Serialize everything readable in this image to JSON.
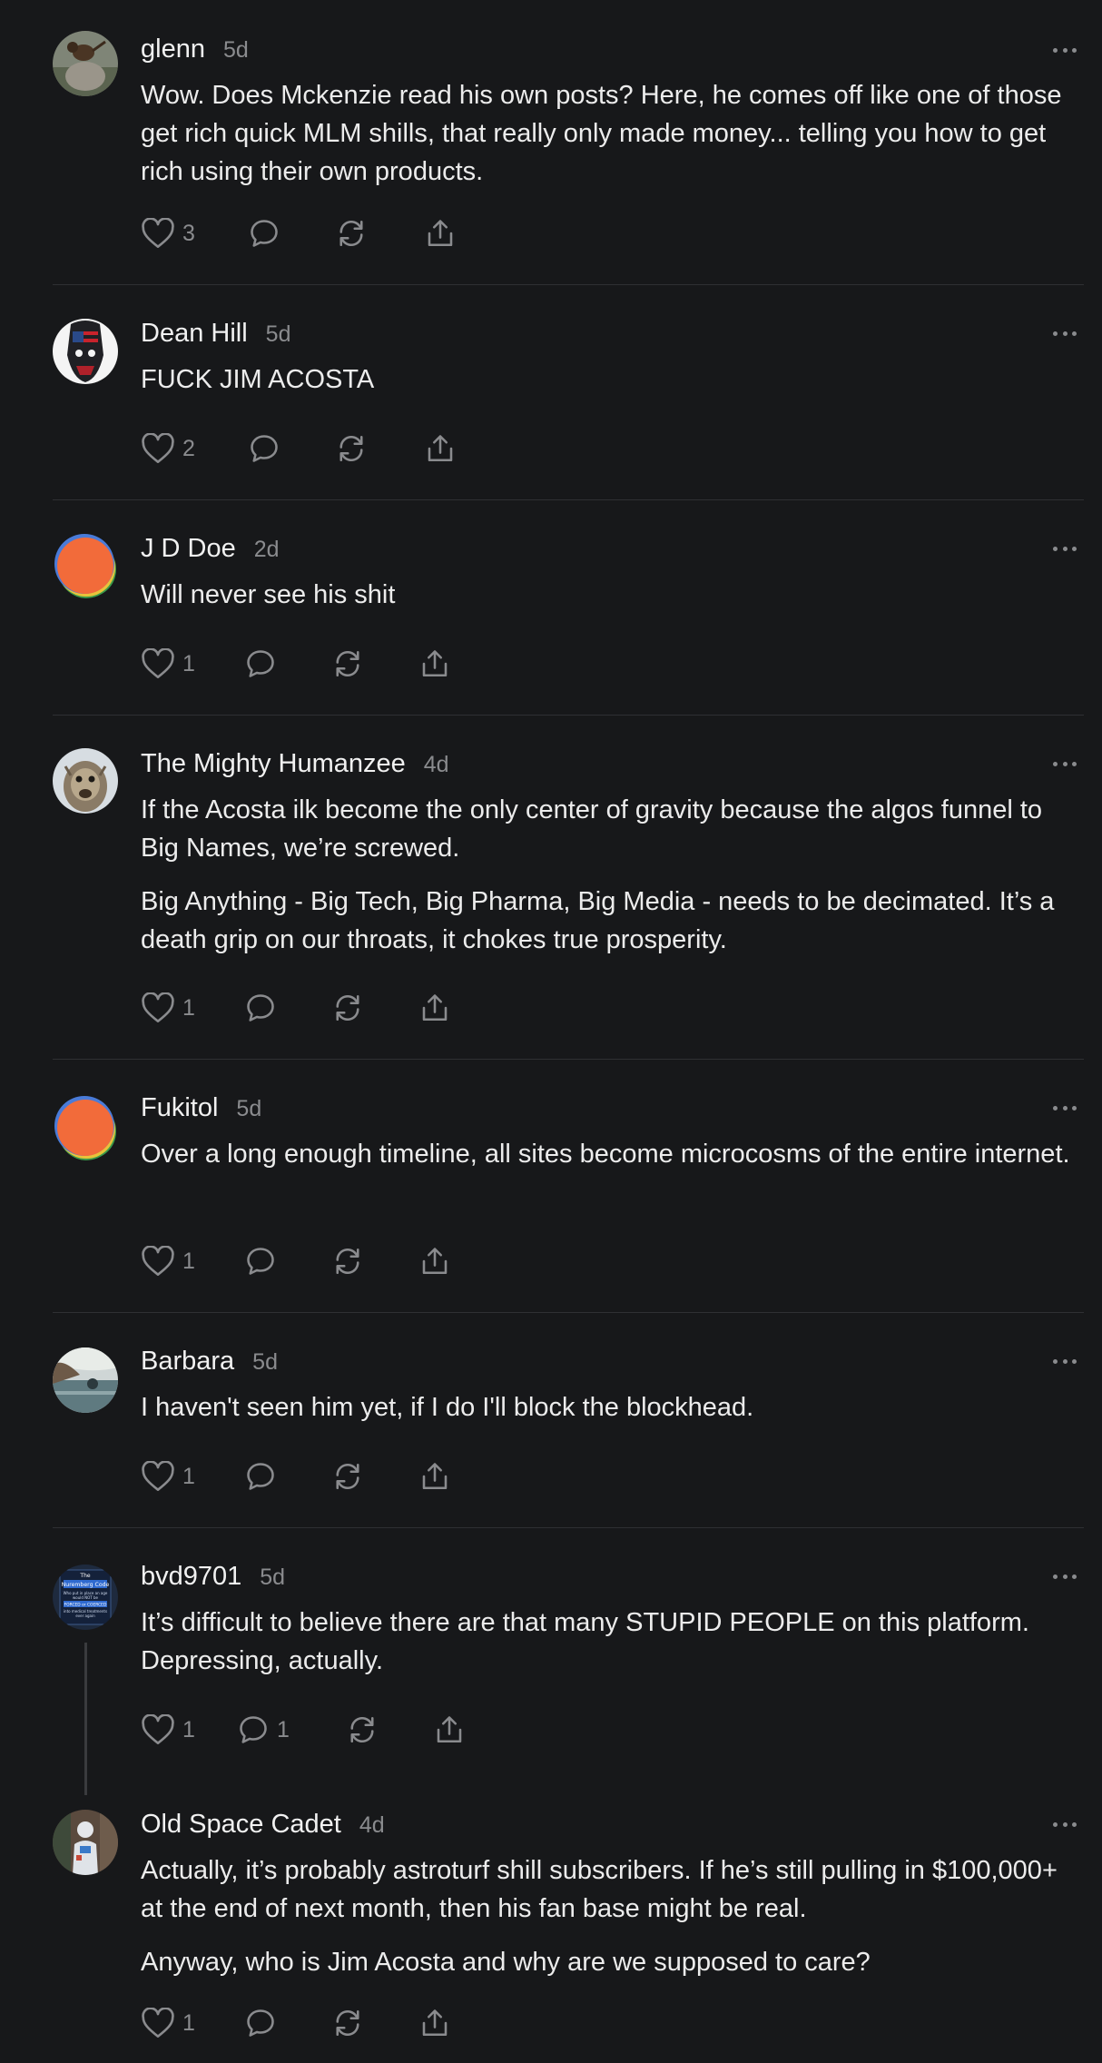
{
  "comments": [
    {
      "author": "glenn",
      "time": "5d",
      "paragraphs": [
        "Wow. Does Mckenzie read his own posts? Here, he comes off like one of those get rich quick MLM shills, that really only made money... telling you how to get rich using their own products."
      ],
      "likes": "3",
      "replies": ""
    },
    {
      "author": "Dean Hill",
      "time": "5d",
      "paragraphs": [
        "FUCK JIM ACOSTA"
      ],
      "likes": "2",
      "replies": ""
    },
    {
      "author": "J D Doe",
      "time": "2d",
      "paragraphs": [
        "Will never see his shit"
      ],
      "likes": "1",
      "replies": ""
    },
    {
      "author": "The Mighty Humanzee",
      "time": "4d",
      "paragraphs": [
        "If the Acosta ilk become the only center of gravity because the algos funnel to Big Names, we’re screwed.",
        "Big Anything - Big Tech, Big Pharma, Big Media - needs to be decimated. It’s a death grip on our throats, it chokes true prosperity."
      ],
      "likes": "1",
      "replies": ""
    },
    {
      "author": "Fukitol",
      "time": "5d",
      "paragraphs": [
        "Over a long enough timeline, all sites become microcosms of the entire internet."
      ],
      "likes": "1",
      "replies": ""
    },
    {
      "author": "Barbara",
      "time": "5d",
      "paragraphs": [
        "I haven't seen him yet, if I do I'll block the blockhead."
      ],
      "likes": "1",
      "replies": ""
    },
    {
      "author": "bvd9701",
      "time": "5d",
      "paragraphs": [
        "It’s difficult to believe there are that many STUPID PEOPLE on this platform. Depressing, actually."
      ],
      "likes": "1",
      "replies": "1",
      "avatar_text": [
        "The",
        "Nuremberg Code",
        "Who put in place an age",
        "would NOT be",
        "FORCED or COERCED",
        "into medical treatments",
        "ever again"
      ]
    },
    {
      "author": "Old Space Cadet",
      "time": "4d",
      "paragraphs": [
        "Actually, it’s probably astroturf shill subscribers. If he’s still pulling in $100,000+ at the end of next month, then his fan base might be real.",
        "Anyway, who is Jim Acosta and why are we supposed to care?"
      ],
      "likes": "1",
      "replies": ""
    }
  ],
  "colors": {
    "background": "#17181a",
    "text": "#ececec",
    "muted": "#8a8b8e",
    "divider": "#2f3033"
  },
  "icons": [
    "heart-icon",
    "comment-icon",
    "restack-icon",
    "share-icon",
    "more-options-icon"
  ]
}
